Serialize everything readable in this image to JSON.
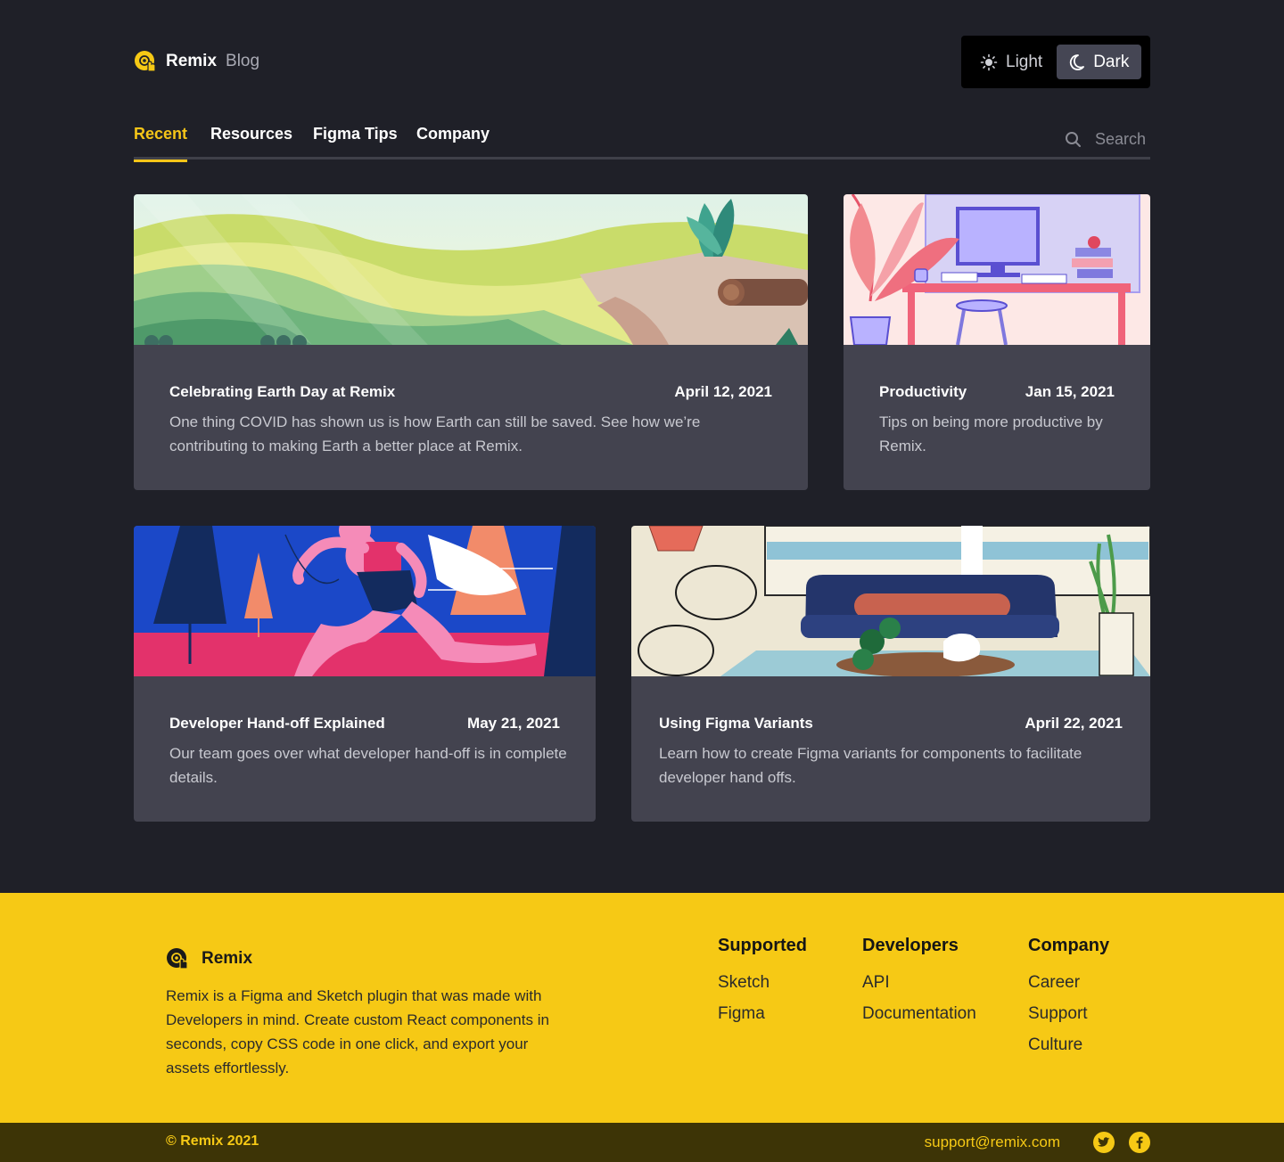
{
  "header": {
    "brand_name": "Remix",
    "brand_sub": "Blog",
    "theme": {
      "light_label": "Light",
      "dark_label": "Dark",
      "selected": "Dark"
    }
  },
  "nav": {
    "tabs": [
      {
        "label": "Recent",
        "active": true
      },
      {
        "label": "Resources",
        "active": false
      },
      {
        "label": "Figma Tips",
        "active": false
      },
      {
        "label": "Company",
        "active": false
      }
    ],
    "search_placeholder": "Search"
  },
  "posts": [
    {
      "title": "Celebrating Earth Day at Remix",
      "date": "April 12, 2021",
      "description": "One thing COVID has shown us is how Earth can still be saved. See how we’re contributing to making Earth a better place at Remix."
    },
    {
      "title": "Productivity",
      "date": "Jan 15, 2021",
      "description": "Tips on being more productive by Remix."
    },
    {
      "title": "Developer Hand-off Explained",
      "date": "May 21, 2021",
      "description": "Our team goes over what developer hand-off is in complete details."
    },
    {
      "title": "Using Figma Variants",
      "date": "April 22, 2021",
      "description": "Learn how to create Figma variants for components to facilitate developer hand offs."
    }
  ],
  "footer": {
    "brand_name": "Remix",
    "description": "Remix is a Figma and Sketch plugin that was made with Developers in mind. Create custom React components in seconds, copy CSS code in one click, and export your assets effortlessly.",
    "columns": [
      {
        "title": "Supported",
        "links": [
          "Sketch",
          "Figma"
        ]
      },
      {
        "title": "Developers",
        "links": [
          "API",
          "Documentation"
        ]
      },
      {
        "title": "Company",
        "links": [
          "Career",
          "Support",
          "Culture"
        ]
      }
    ],
    "copyright": "© Remix 2021",
    "support_email": "support@remix.com",
    "social": [
      "twitter-icon",
      "facebook-icon"
    ]
  },
  "colors": {
    "accent": "#f6c915",
    "background": "#1f2028",
    "card": "#43434f",
    "footer": "#f6c915"
  }
}
